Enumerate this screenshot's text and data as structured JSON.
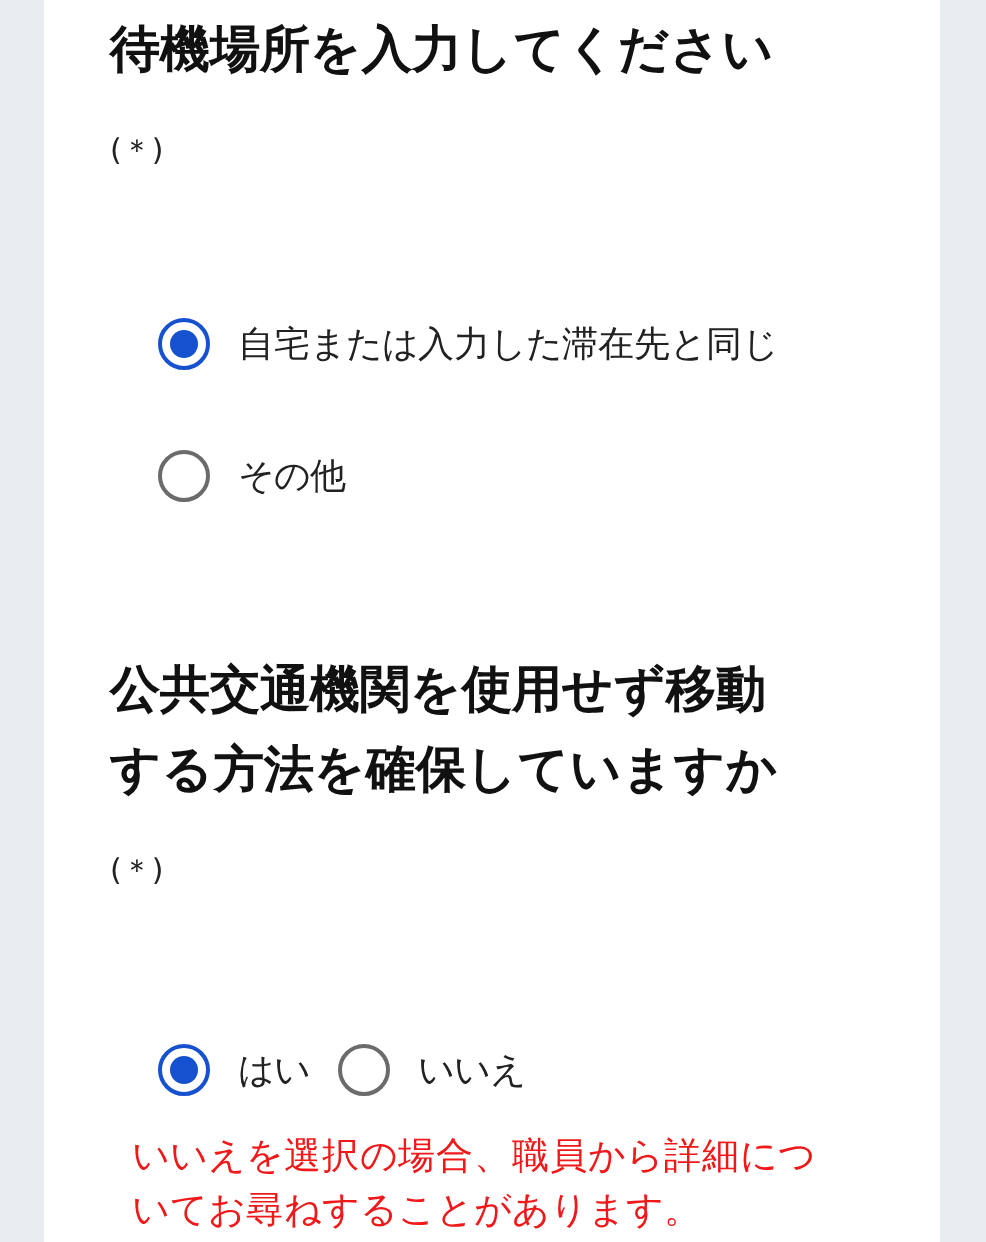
{
  "questions": [
    {
      "title": "待機場所を入力してください",
      "required_mark": "(＊)",
      "kind": "stacked",
      "options": [
        {
          "label": "自宅または入力した滞在先と同じ",
          "selected": true
        },
        {
          "label": "その他",
          "selected": false
        }
      ]
    },
    {
      "title": "公共交通機関を使用せず移動する方法を確保していますか",
      "required_mark": "(＊)",
      "kind": "inline",
      "options": [
        {
          "label": "はい",
          "selected": true
        },
        {
          "label": "いいえ",
          "selected": false
        }
      ],
      "note": "いいえを選択の場合、職員から詳細についてお尋ねすることがあります。"
    }
  ]
}
